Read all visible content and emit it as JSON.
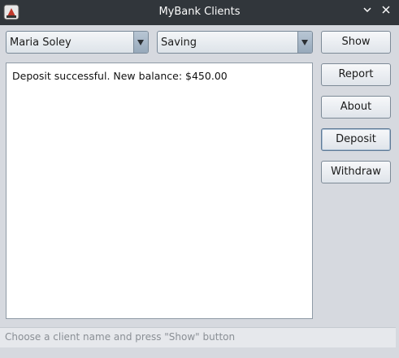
{
  "window": {
    "title": "MyBank Clients",
    "minimize_glyph": "⌵",
    "close_glyph": "✕"
  },
  "controls": {
    "client_selected": "Maria Soley",
    "account_selected": "Saving"
  },
  "output": {
    "text": "Deposit successful. New balance: $450.00"
  },
  "buttons": {
    "show": "Show",
    "report": "Report",
    "about": "About",
    "deposit": "Deposit",
    "withdraw": "Withdraw"
  },
  "status": {
    "text": "Choose a client name and press \"Show\" button"
  },
  "colors": {
    "titlebar": "#31363b",
    "window_bg": "#d6d9df",
    "focused_button_border": "#5e7a96"
  }
}
